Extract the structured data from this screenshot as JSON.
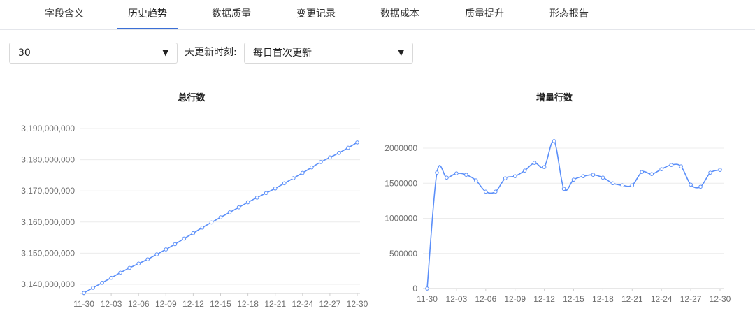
{
  "tabs": [
    {
      "label": "字段含义",
      "active": false
    },
    {
      "label": "历史趋势",
      "active": true
    },
    {
      "label": "数据质量",
      "active": false
    },
    {
      "label": "变更记录",
      "active": false
    },
    {
      "label": "数据成本",
      "active": false
    },
    {
      "label": "质量提升",
      "active": false
    },
    {
      "label": "形态报告",
      "active": false
    }
  ],
  "filters": {
    "days_value": "30",
    "update_label": "天更新时刻:",
    "update_value": "每日首次更新"
  },
  "colors": {
    "line": "#5b8ff9",
    "grid": "#ececec",
    "accent": "#3b6fd6"
  },
  "chart_data": [
    {
      "type": "line",
      "title": "总行数",
      "x": [
        "11-30",
        "12-01",
        "12-02",
        "12-03",
        "12-04",
        "12-05",
        "12-06",
        "12-07",
        "12-08",
        "12-09",
        "12-10",
        "12-11",
        "12-12",
        "12-13",
        "12-14",
        "12-15",
        "12-16",
        "12-17",
        "12-18",
        "12-19",
        "12-20",
        "12-21",
        "12-22",
        "12-23",
        "12-24",
        "12-25",
        "12-26",
        "12-27",
        "12-28",
        "12-29",
        "12-30"
      ],
      "x_tick_labels": [
        "11-30",
        "12-03",
        "12-06",
        "12-09",
        "12-12",
        "12-15",
        "12-18",
        "12-21",
        "12-24",
        "12-27",
        "12-30"
      ],
      "y_ticks": [
        3140000000,
        3150000000,
        3160000000,
        3170000000,
        3180000000,
        3190000000
      ],
      "y_tick_labels": [
        "3,140,000,000",
        "3,150,000,000",
        "3,160,000,000",
        "3,170,000,000",
        "3,180,000,000",
        "3,190,000,000"
      ],
      "ylim": [
        3140000000,
        3190000000
      ],
      "values": [
        3137250000,
        3138900000,
        3140480000,
        3142100000,
        3143740000,
        3145280000,
        3146660000,
        3148040000,
        3149620000,
        3151220000,
        3152900000,
        3154700000,
        3156440000,
        3158220000,
        3159860000,
        3161500000,
        3163100000,
        3164720000,
        3166340000,
        3167840000,
        3169310000,
        3170780000,
        3172440000,
        3174070000,
        3175770000,
        3177530000,
        3179250000,
        3180730000,
        3182190000,
        3183840000,
        3185530000
      ],
      "grid": true
    },
    {
      "type": "line",
      "title": "增量行数",
      "x": [
        "11-30",
        "12-01",
        "12-02",
        "12-03",
        "12-04",
        "12-05",
        "12-06",
        "12-07",
        "12-08",
        "12-09",
        "12-10",
        "12-11",
        "12-12",
        "12-13",
        "12-14",
        "12-15",
        "12-16",
        "12-17",
        "12-18",
        "12-19",
        "12-20",
        "12-21",
        "12-22",
        "12-23",
        "12-24",
        "12-25",
        "12-26",
        "12-27",
        "12-28",
        "12-29",
        "12-30"
      ],
      "x_tick_labels": [
        "11-30",
        "12-03",
        "12-06",
        "12-09",
        "12-12",
        "12-15",
        "12-18",
        "12-21",
        "12-24",
        "12-27",
        "12-30"
      ],
      "y_ticks": [
        0,
        500000,
        1000000,
        1500000,
        2000000
      ],
      "y_tick_labels": [
        "0",
        "500000",
        "1000000",
        "1500000",
        "2000000"
      ],
      "ylim": [
        0,
        2000000
      ],
      "values": [
        0,
        1650000,
        1580000,
        1640000,
        1620000,
        1540000,
        1380000,
        1380000,
        1570000,
        1600000,
        1680000,
        1790000,
        1730000,
        2100000,
        1420000,
        1550000,
        1600000,
        1620000,
        1580000,
        1500000,
        1470000,
        1470000,
        1660000,
        1630000,
        1700000,
        1760000,
        1740000,
        1480000,
        1450000,
        1650000,
        1690000
      ],
      "grid": true
    }
  ]
}
